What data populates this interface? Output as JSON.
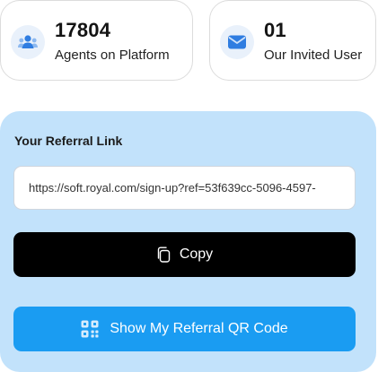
{
  "stats": [
    {
      "value": "17804",
      "label": "Agents on Platform",
      "icon": "agents-icon"
    },
    {
      "value": "01",
      "label": "Our Invited User",
      "icon": "mail-icon"
    }
  ],
  "referral": {
    "title": "Your Referral Link",
    "link": "https://soft.royal.com/sign-up?ref=53f639cc-5096-4597-",
    "copy_label": "Copy",
    "qr_label": "Show My Referral QR Code"
  },
  "colors": {
    "panel_bg": "#c2e2fb",
    "accent_blue": "#1a9cf2",
    "copy_bg": "#000000",
    "icon_blue": "#2f7de1"
  }
}
